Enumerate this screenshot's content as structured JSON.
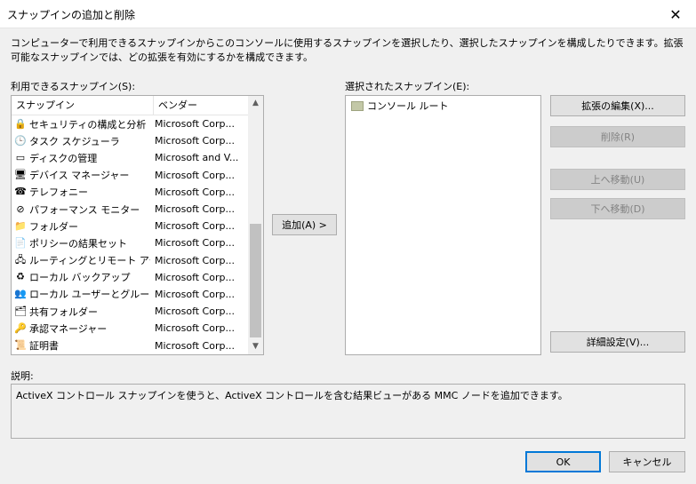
{
  "window": {
    "title": "スナップインの追加と削除",
    "close_glyph": "✕"
  },
  "description": "コンピューターで利用できるスナップインからこのコンソールに使用するスナップインを選択したり、選択したスナップインを構成したりできます。拡張可能なスナップインでは、どの拡張を有効にするかを構成できます。",
  "available": {
    "label": "利用できるスナップイン(S):",
    "columns": {
      "name": "スナップイン",
      "vendor": "ベンダー"
    },
    "items": [
      {
        "name": "セキュリティの構成と分析",
        "vendor": "Microsoft Corp...",
        "icon": "security-config-icon",
        "glyph": "🔒"
      },
      {
        "name": "タスク スケジューラ",
        "vendor": "Microsoft Corp...",
        "icon": "clock-icon",
        "glyph": "🕒"
      },
      {
        "name": "ディスクの管理",
        "vendor": "Microsoft and V...",
        "icon": "disk-icon",
        "glyph": "▭"
      },
      {
        "name": "デバイス マネージャー",
        "vendor": "Microsoft Corp...",
        "icon": "device-manager-icon",
        "glyph": "🖥"
      },
      {
        "name": "テレフォニー",
        "vendor": "Microsoft Corp...",
        "icon": "telephony-icon",
        "glyph": "☎"
      },
      {
        "name": "パフォーマンス モニター",
        "vendor": "Microsoft Corp...",
        "icon": "performance-icon",
        "glyph": "⊘"
      },
      {
        "name": "フォルダー",
        "vendor": "Microsoft Corp...",
        "icon": "folder-icon",
        "glyph": "📁"
      },
      {
        "name": "ポリシーの結果セット",
        "vendor": "Microsoft Corp...",
        "icon": "policy-icon",
        "glyph": "📄"
      },
      {
        "name": "ルーティングとリモート アクセス",
        "vendor": "Microsoft Corp...",
        "icon": "routing-icon",
        "glyph": "🖧"
      },
      {
        "name": "ローカル バックアップ",
        "vendor": "Microsoft Corp...",
        "icon": "backup-icon",
        "glyph": "♻"
      },
      {
        "name": "ローカル ユーザーとグループ",
        "vendor": "Microsoft Corp...",
        "icon": "users-icon",
        "glyph": "👥"
      },
      {
        "name": "共有フォルダー",
        "vendor": "Microsoft Corp...",
        "icon": "shared-folder-icon",
        "glyph": "🗂"
      },
      {
        "name": "承認マネージャー",
        "vendor": "Microsoft Corp...",
        "icon": "authorization-icon",
        "glyph": "🔑"
      },
      {
        "name": "証明書",
        "vendor": "Microsoft Corp...",
        "icon": "certificate-icon",
        "glyph": "📜"
      }
    ]
  },
  "add_button": "追加(A) >",
  "selected": {
    "label": "選択されたスナップイン(E):",
    "root": "コンソール ルート"
  },
  "buttons": {
    "edit_extensions": "拡張の編集(X)...",
    "remove": "削除(R)",
    "move_up": "上へ移動(U)",
    "move_down": "下へ移動(D)",
    "advanced": "詳細設定(V)...",
    "ok": "OK",
    "cancel": "キャンセル"
  },
  "explanation": {
    "label": "説明:",
    "text": "ActiveX コントロール スナップインを使うと、ActiveX コントロールを含む結果ビューがある MMC ノードを追加できます。"
  },
  "colors": {
    "accent": "#0078d7",
    "disabled_text": "#838383"
  }
}
